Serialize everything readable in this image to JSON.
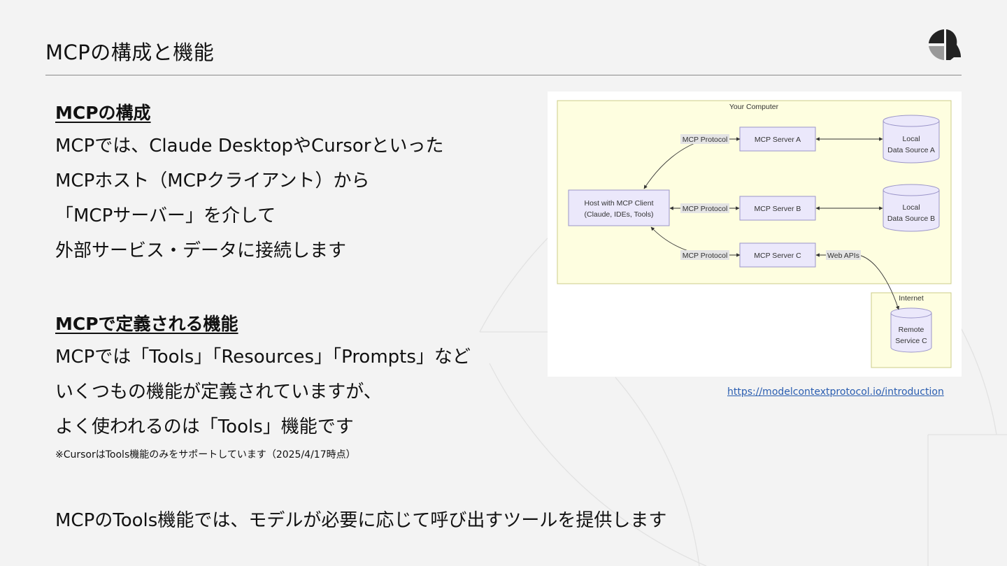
{
  "slide": {
    "title": "MCPの構成と機能"
  },
  "section1": {
    "heading": "MCPの構成",
    "lines": [
      "MCPでは、Claude DesktopやCursorといった",
      "MCPホスト（MCPクライアント）から",
      "「MCPサーバー」を介して",
      "外部サービス・データに接続します"
    ]
  },
  "section2": {
    "heading": "MCPで定義される機能",
    "lines": [
      "MCPでは「Tools」「Resources」「Prompts」など",
      "いくつもの機能が定義されていますが、",
      "よく使われるのは「Tools」機能です"
    ],
    "note": "※CursorはTools機能のみをサポートしています（2025/4/17時点）"
  },
  "closing": "MCPのTools機能では、モデルが必要に応じて呼び出すツールを提供します",
  "diagram": {
    "computer_label": "Your Computer",
    "internet_label": "Internet",
    "host": {
      "line1": "Host with MCP Client",
      "line2": "(Claude, IDEs, Tools)"
    },
    "servers": [
      "MCP Server A",
      "MCP Server B",
      "MCP Server C"
    ],
    "protocol_label": "MCP Protocol",
    "web_apis_label": "Web APIs",
    "sources": [
      {
        "line1": "Local",
        "line2": "Data Source A"
      },
      {
        "line1": "Local",
        "line2": "Data Source B"
      }
    ],
    "remote": {
      "line1": "Remote",
      "line2": "Service C"
    },
    "colors": {
      "computer_bg": "#fefee0",
      "node_fill": "#ebe8fb",
      "node_stroke": "#9b95c9"
    }
  },
  "source_link": "https://modelcontextprotocol.io/introduction"
}
